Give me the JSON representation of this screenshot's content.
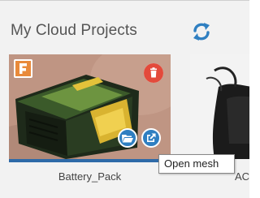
{
  "header": {
    "title": "My Cloud Projects",
    "refresh_icon": "refresh-icon"
  },
  "projects": [
    {
      "name": "Battery_Pack",
      "source_badge": "F",
      "actions": [
        "trash-icon",
        "folder-open-icon",
        "external-link-icon"
      ]
    },
    {
      "name": "AC"
    }
  ],
  "tooltip": {
    "text": "Open mesh"
  },
  "colors": {
    "background": "#f2f2f2",
    "title_text": "#555555",
    "accent_blue": "#2f7fc1",
    "progress_bar": "#2e6aa8",
    "delete_red": "#e34a3b",
    "badge_orange": "#e98a3a"
  }
}
